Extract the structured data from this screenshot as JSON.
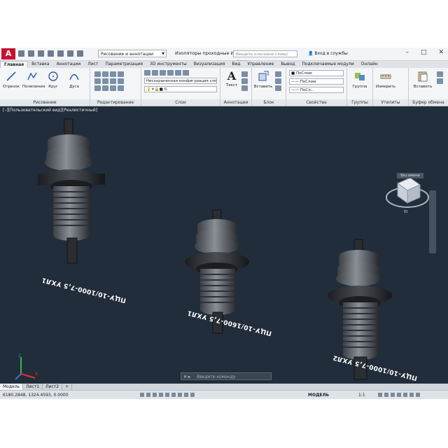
{
  "app": {
    "logo": "A",
    "title": "Изоляторы проходные И...",
    "workspace": "Рисование и аннотации",
    "search_placeholder": "Введите ключевое слово/фразу",
    "login": "Вход в службы"
  },
  "tabs": [
    "Главная",
    "Вставка",
    "Аннотации",
    "Лист",
    "Параметризация",
    "3D инструменты",
    "Визуализация",
    "Вид",
    "Управление",
    "Вывод",
    "Подключаемые модули",
    "Онлайн"
  ],
  "ribbon": {
    "draw": {
      "title": "Рисование",
      "line": "Отрезок",
      "polyline": "Полилиния",
      "circle": "Круг",
      "arc": "Дуга"
    },
    "modify": {
      "title": "Редактирование"
    },
    "layers": {
      "title": "Слои",
      "layer_combo": "Несохраненная конфигурация сло",
      "layer_value": "0"
    },
    "annotation": {
      "title": "Аннотации",
      "text": "Текст"
    },
    "block": {
      "title": "Блок",
      "insert": "Вставить"
    },
    "properties": {
      "title": "Свойства",
      "color": "ПоСлою",
      "linetype": "ПоСлою",
      "lineweight": "ПоСл..."
    },
    "groups": {
      "title": "Группы",
      "group": "Группа"
    },
    "utilities": {
      "title": "Утилиты",
      "measure": "Измерить"
    },
    "clipboard": {
      "title": "Буфер обмена",
      "paste": "Вставить"
    }
  },
  "viewport": {
    "label": "[–][Пользовательский вид][Реалистичный]",
    "unnamed": "Без имени",
    "labels": [
      "ПЦУ-10/1000-7,5 УХЛ1",
      "ПЦУ-10/1600-7,5 УХЛ1",
      "ПЦУ-10/1000-7,5 УХЛ2"
    ]
  },
  "command_placeholder": "Введите команду",
  "layout_tabs": [
    "Модель",
    "Лист1",
    "Лист2"
  ],
  "status": {
    "coords": "6180.2848, 1324.4593, 0.0000",
    "model": "МОДЕЛЬ",
    "scale": "1:1"
  }
}
